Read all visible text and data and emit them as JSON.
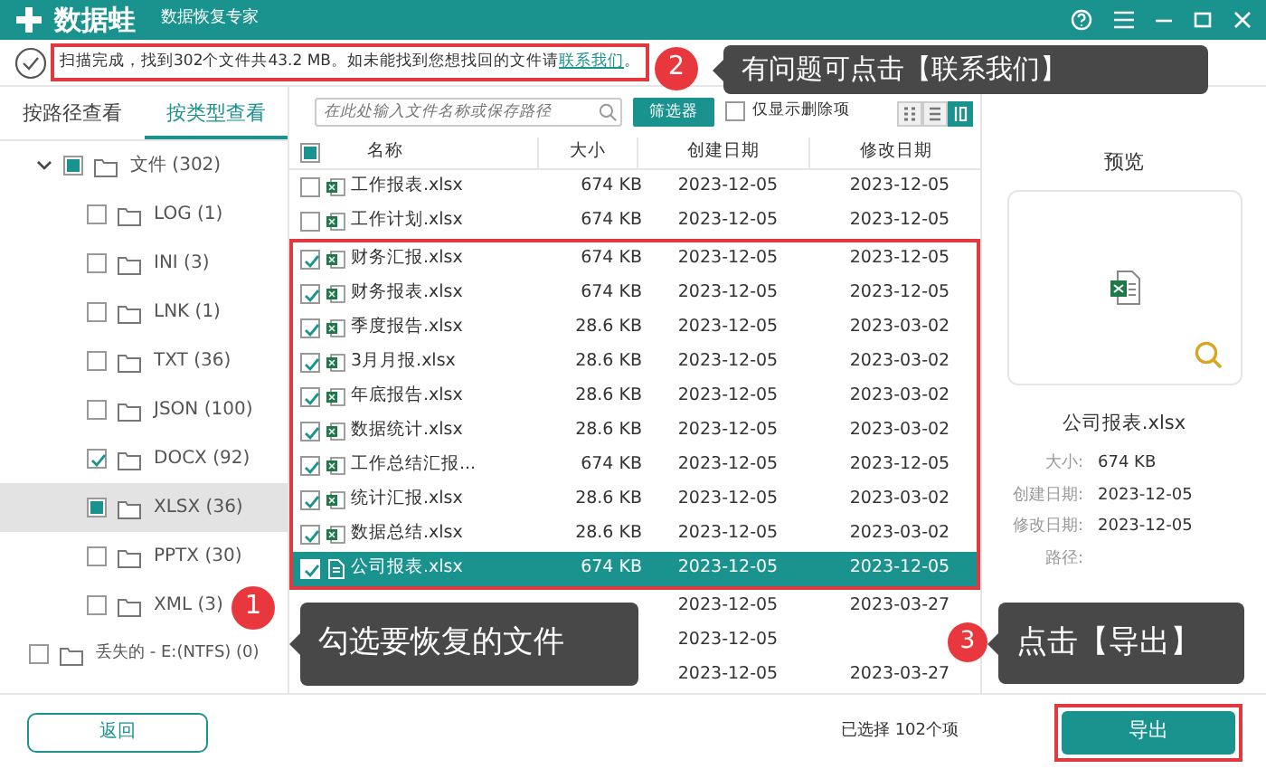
{
  "app": {
    "logo": "数据蛙",
    "subtitle": "数据恢复专家"
  },
  "info_bar": {
    "text": "扫描完成，找到302个文件共43.2 MB。如未能找到您想找回的文件请",
    "link": "联系我们",
    "suffix": "。",
    "highlighted": true
  },
  "view_tabs": [
    {
      "label": "按路径查看",
      "selected": false
    },
    {
      "label": "按类型查看",
      "selected": true
    }
  ],
  "tree": [
    {
      "label": "文件 (302)",
      "checked": false,
      "indeterminate": true,
      "expanded": true,
      "selected": false,
      "children": [
        {
          "label": "LOG (1)",
          "checked": false,
          "indeterminate": false,
          "selected": false
        },
        {
          "label": "INI (3)",
          "checked": false,
          "indeterminate": false,
          "selected": false
        },
        {
          "label": "LNK (1)",
          "checked": false,
          "indeterminate": false,
          "selected": false
        },
        {
          "label": "TXT (36)",
          "checked": false,
          "indeterminate": false,
          "selected": false
        },
        {
          "label": "JSON (100)",
          "checked": false,
          "indeterminate": false,
          "selected": false
        },
        {
          "label": "DOCX (92)",
          "checked": true,
          "indeterminate": false,
          "selected": false
        },
        {
          "label": "XLSX (36)",
          "checked": false,
          "indeterminate": true,
          "selected": true
        },
        {
          "label": "PPTX (30)",
          "checked": false,
          "indeterminate": false,
          "selected": false
        },
        {
          "label": "XML (3)",
          "checked": false,
          "indeterminate": false,
          "selected": false
        }
      ]
    },
    {
      "label": "丢失的 - E:(NTFS) (0)",
      "checked": false,
      "indeterminate": false,
      "selected": false
    }
  ],
  "search": {
    "placeholder": "在此处输入文件名称或保存路径"
  },
  "filter_button": "筛选器",
  "deleted_only": {
    "label": "仅显示删除项",
    "checked": false
  },
  "view_modes": [
    {
      "selected": false
    },
    {
      "selected": false
    },
    {
      "selected": true
    }
  ],
  "table": {
    "header_checkbox": {
      "checked": false,
      "indeterminate": true
    },
    "columns": [
      "名称",
      "大小",
      "创建日期",
      "修改日期"
    ],
    "rows": [
      {
        "checked": false,
        "selected": false,
        "highlighted": false,
        "name": "工作报表.xlsx",
        "size": "674 KB",
        "created": "2023-12-05",
        "modified": "2023-12-05"
      },
      {
        "checked": false,
        "selected": false,
        "highlighted": false,
        "name": "工作计划.xlsx",
        "size": "674 KB",
        "created": "2023-12-05",
        "modified": "2023-12-05"
      },
      {
        "checked": true,
        "selected": false,
        "highlighted": true,
        "name": "财务汇报.xlsx",
        "size": "674 KB",
        "created": "2023-12-05",
        "modified": "2023-12-05"
      },
      {
        "checked": true,
        "selected": false,
        "highlighted": true,
        "name": "财务报表.xlsx",
        "size": "674 KB",
        "created": "2023-12-05",
        "modified": "2023-12-05"
      },
      {
        "checked": true,
        "selected": false,
        "highlighted": true,
        "name": "季度报告.xlsx",
        "size": "28.6 KB",
        "created": "2023-12-05",
        "modified": "2023-03-02"
      },
      {
        "checked": true,
        "selected": false,
        "highlighted": true,
        "name": "3月月报.xlsx",
        "size": "28.6 KB",
        "created": "2023-12-05",
        "modified": "2023-03-02"
      },
      {
        "checked": true,
        "selected": false,
        "highlighted": true,
        "name": "年底报告.xlsx",
        "size": "28.6 KB",
        "created": "2023-12-05",
        "modified": "2023-03-02"
      },
      {
        "checked": true,
        "selected": false,
        "highlighted": true,
        "name": "数据统计.xlsx",
        "size": "28.6 KB",
        "created": "2023-12-05",
        "modified": "2023-03-02"
      },
      {
        "checked": true,
        "selected": false,
        "highlighted": true,
        "name": "工作总结汇报...",
        "size": "674 KB",
        "created": "2023-12-05",
        "modified": "2023-12-05"
      },
      {
        "checked": true,
        "selected": false,
        "highlighted": true,
        "name": "统计汇报.xlsx",
        "size": "28.6 KB",
        "created": "2023-12-05",
        "modified": "2023-03-02"
      },
      {
        "checked": true,
        "selected": false,
        "highlighted": true,
        "name": "数据总结.xlsx",
        "size": "28.6 KB",
        "created": "2023-12-05",
        "modified": "2023-03-02"
      },
      {
        "checked": true,
        "selected": true,
        "highlighted": true,
        "name": "公司报表.xlsx",
        "size": "674 KB",
        "created": "2023-12-05",
        "modified": "2023-12-05"
      },
      {
        "created": "2023-12-05",
        "modified": "2023-03-27"
      },
      {
        "created": "2023-12-05"
      },
      {
        "created": "2023-12-05",
        "modified": "2023-03-27"
      }
    ]
  },
  "preview": {
    "title": "预览",
    "file_name": "公司报表.xlsx",
    "details": [
      {
        "label": "大小:",
        "value": "674 KB"
      },
      {
        "label": "创建日期:",
        "value": "2023-12-05"
      },
      {
        "label": "修改日期:",
        "value": "2023-12-05"
      },
      {
        "label": "路径:"
      }
    ]
  },
  "footer": {
    "back_button": "返回",
    "selection": "已选择 102个项",
    "export_button": "导出",
    "export_highlighted": true
  },
  "callouts": [
    {
      "number": "1",
      "text": "勾选要恢复的文件"
    },
    {
      "number": "2",
      "text": "有问题可点击【联系我们】"
    },
    {
      "number": "3",
      "text": "点击【导出】"
    }
  ]
}
